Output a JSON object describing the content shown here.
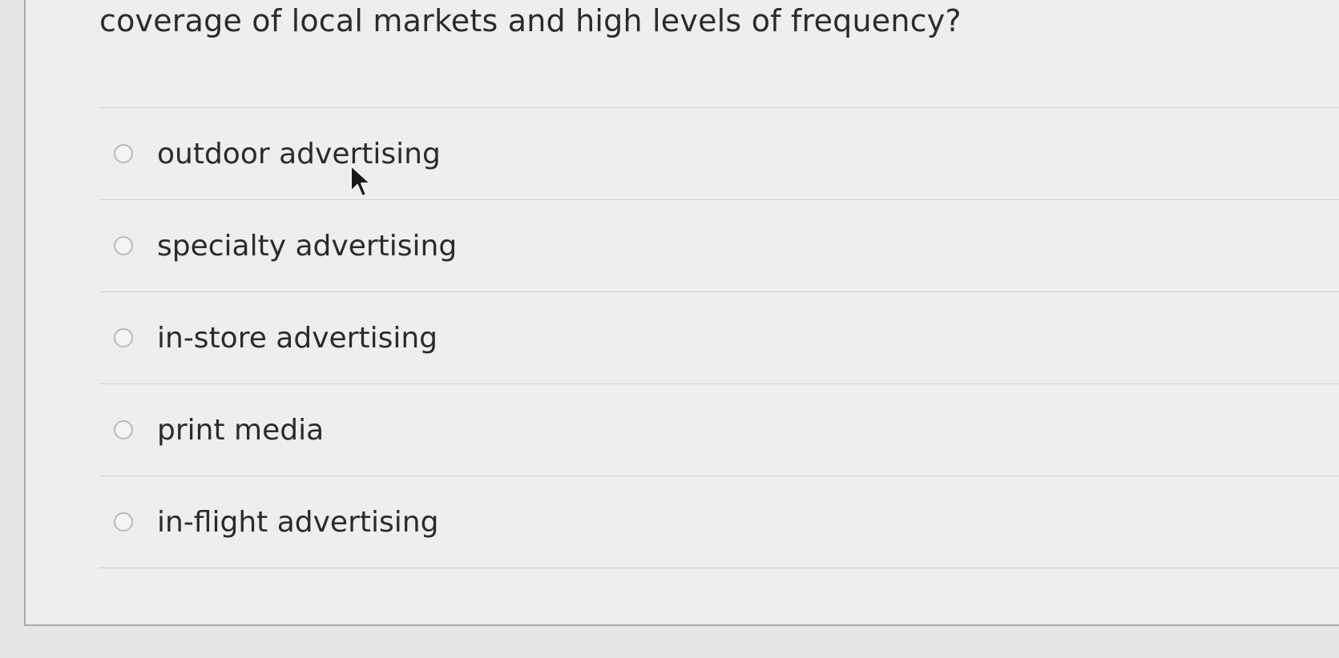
{
  "question": {
    "text": "coverage of local markets and high levels of frequency?"
  },
  "options": [
    {
      "label": "outdoor advertising",
      "selected": false
    },
    {
      "label": "specialty advertising",
      "selected": false
    },
    {
      "label": "in-store advertising",
      "selected": false
    },
    {
      "label": "print media",
      "selected": false
    },
    {
      "label": "in-flight advertising",
      "selected": false
    }
  ],
  "cursor": {
    "icon": "arrow-pointer-icon"
  }
}
